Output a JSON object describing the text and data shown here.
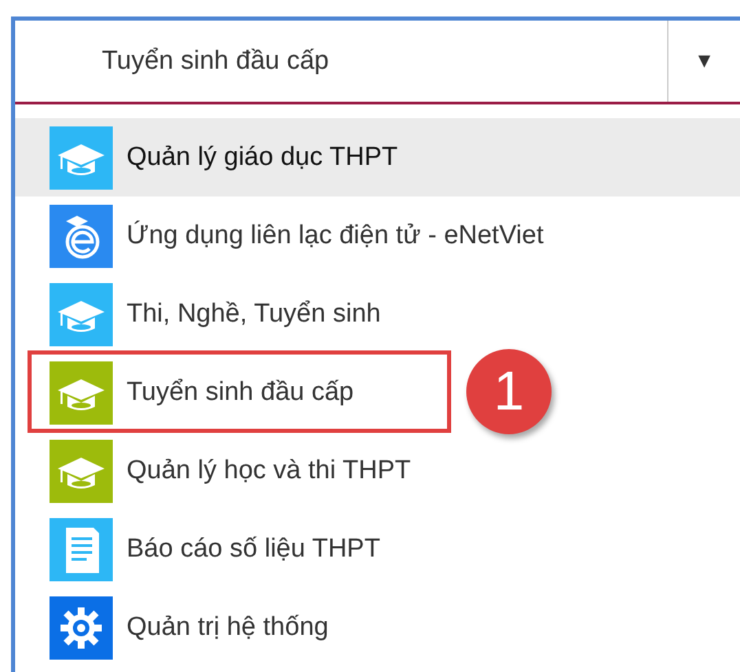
{
  "dropdown": {
    "value": "Tuyển sinh đầu cấp",
    "caret": "▼"
  },
  "items": [
    {
      "label": "Quản lý giáo dục THPT",
      "kind": "cap",
      "color": "#2db7f5",
      "highlighted": true,
      "marked": false
    },
    {
      "label": "Ứng dụng liên lạc điện tử - eNetViet",
      "kind": "enetviet",
      "color": "#2a8af0",
      "highlighted": false,
      "marked": false
    },
    {
      "label": "Thi, Nghề, Tuyển sinh",
      "kind": "cap",
      "color": "#2db7f5",
      "highlighted": false,
      "marked": false
    },
    {
      "label": "Tuyển sinh đầu cấp",
      "kind": "cap",
      "color": "#9dbb0c",
      "highlighted": false,
      "marked": true,
      "callout": "1"
    },
    {
      "label": "Quản lý học và thi THPT",
      "kind": "cap",
      "color": "#9dbb0c",
      "highlighted": false,
      "marked": false
    },
    {
      "label": "Báo cáo số liệu THPT",
      "kind": "report",
      "color": "#2db7f5",
      "highlighted": false,
      "marked": false
    },
    {
      "label": "Quản trị hệ thống",
      "kind": "gear",
      "color": "#0b6fe6",
      "highlighted": false,
      "marked": false
    }
  ]
}
